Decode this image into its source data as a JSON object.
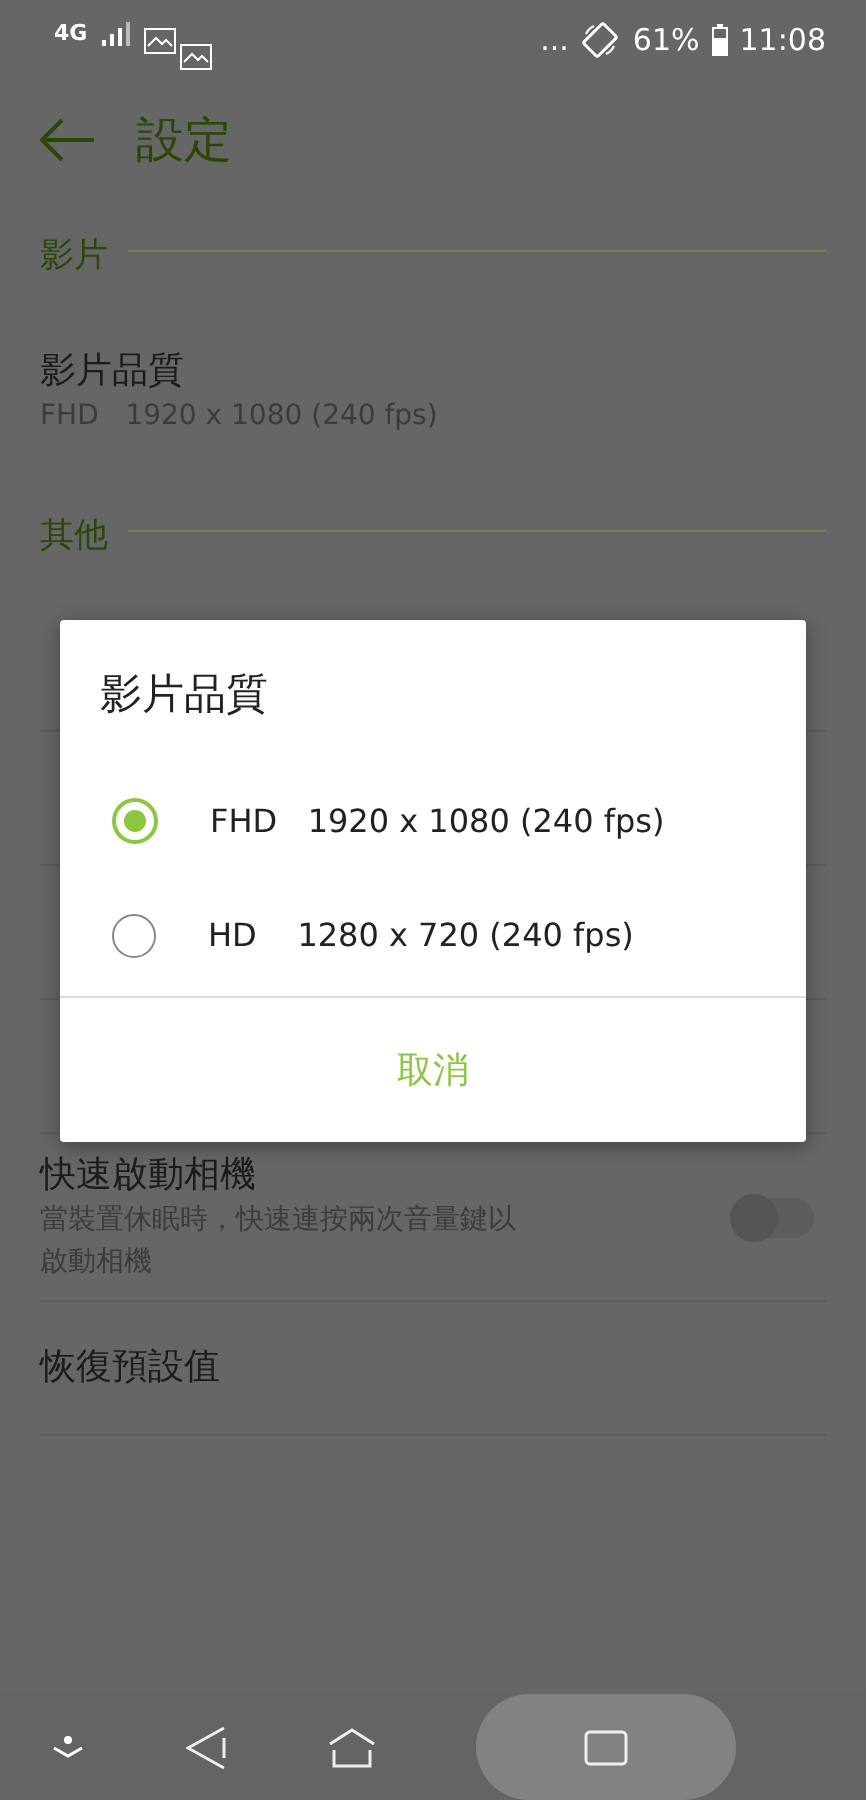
{
  "status_bar": {
    "network": "4G",
    "more": "...",
    "battery": "61%",
    "time": "11:08"
  },
  "header": {
    "title": "設定"
  },
  "sections": [
    {
      "title": "影片",
      "items": [
        {
          "title": "影片品質",
          "subtitle": "FHD   1920 x 1080 (240 fps)"
        }
      ]
    },
    {
      "title": "其他",
      "items": [
        {
          "title": "快速啟動相機",
          "subtitle": "當裝置休眠時，快速連按兩次音量鍵以啟動相機",
          "kind": "toggle",
          "on": false
        },
        {
          "title": "恢復預設值"
        }
      ]
    }
  ],
  "dialog": {
    "title": "影片品質",
    "options": [
      {
        "label": "FHD   1920 x 1080 (240 fps)",
        "selected": true
      },
      {
        "label": "HD    1280 x 720 (240 fps)",
        "selected": false
      }
    ],
    "cancel": "取消"
  }
}
